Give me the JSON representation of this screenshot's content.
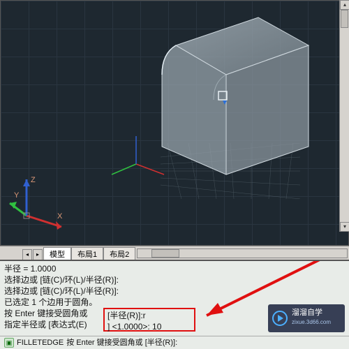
{
  "tabs": {
    "model": "模型",
    "layout1": "布局1",
    "layout2": "布局2"
  },
  "cmd": {
    "l1": "半径 = 1.0000",
    "l2": "选择边或 [链(C)/环(L)/半径(R)]:",
    "l3": "选择边或 [链(C)/环(L)/半径(R)]:",
    "l4": "已选定 1 个边用于圆角。",
    "l5_pre": "按 Enter 键接受圆角或",
    "l5_box": "[半径(R)]:r",
    "l6_pre": "指定半径或 [表达式(E)",
    "l6_box": "] <1.0000>: 10"
  },
  "footer": {
    "icon_glyph": "▣",
    "cmd_name": "FILLETEDGE",
    "rest": "按 Enter 键接受圆角或 [半径(R)]:"
  },
  "axis_labels": {
    "x": "X",
    "y": "Y",
    "z": "Z"
  },
  "watermark": {
    "title": "溜溜自学",
    "sub": "zixue.3d66.com"
  }
}
